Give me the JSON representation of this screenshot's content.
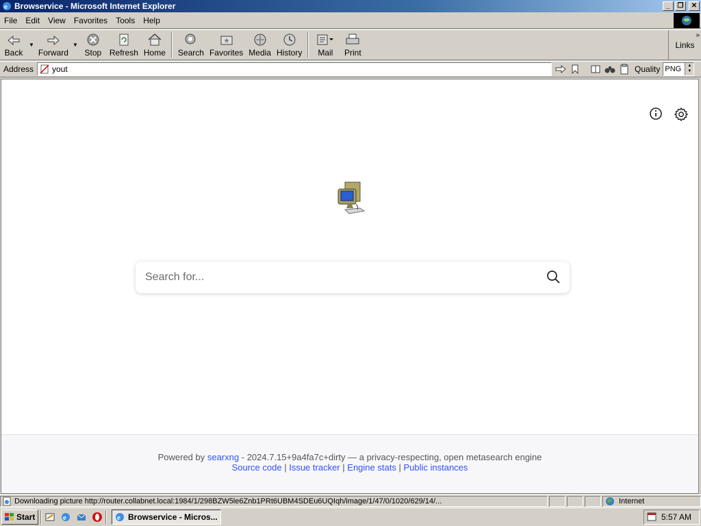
{
  "window": {
    "title": "Browservice - Microsoft Internet Explorer",
    "controls": {
      "minimize": "_",
      "restore": "❐",
      "close": "✕"
    }
  },
  "menubar": {
    "items": [
      {
        "label": "File"
      },
      {
        "label": "Edit"
      },
      {
        "label": "View"
      },
      {
        "label": "Favorites"
      },
      {
        "label": "Tools"
      },
      {
        "label": "Help"
      }
    ]
  },
  "toolbar": {
    "back": "Back",
    "forward": "Forward",
    "stop": "Stop",
    "refresh": "Refresh",
    "home": "Home",
    "search": "Search",
    "favorites": "Favorites",
    "media": "Media",
    "history": "History",
    "mail": "Mail",
    "print": "Print",
    "links": "Links"
  },
  "addressbar": {
    "label": "Address",
    "value": "yout",
    "quality_label": "Quality",
    "quality_value": "PNG"
  },
  "page": {
    "search_placeholder": "Search for...",
    "footer": {
      "powered_by": "Powered by",
      "engine_link": "searxng",
      "version_text": "- 2024.7.15+9a4fa7c+dirty — a privacy-respecting, open metasearch engine",
      "links": [
        "Source code",
        "Issue tracker",
        "Engine stats",
        "Public instances"
      ],
      "separator": "|"
    }
  },
  "statusbar": {
    "text": "Downloading picture http://router.collabnet.local:1984/1/298BZW5le6Znb1PRt6UBM4SDEu6UQIqh/image/1/47/0/1020/629/14/...",
    "zone": "Internet"
  },
  "taskbar": {
    "start": "Start",
    "task": "Browservice - Micros...",
    "clock": "5:57 AM"
  },
  "colors": {
    "title_gradient_start": "#0a246a",
    "link": "#3050ff",
    "chrome": "#d4d0c8"
  }
}
